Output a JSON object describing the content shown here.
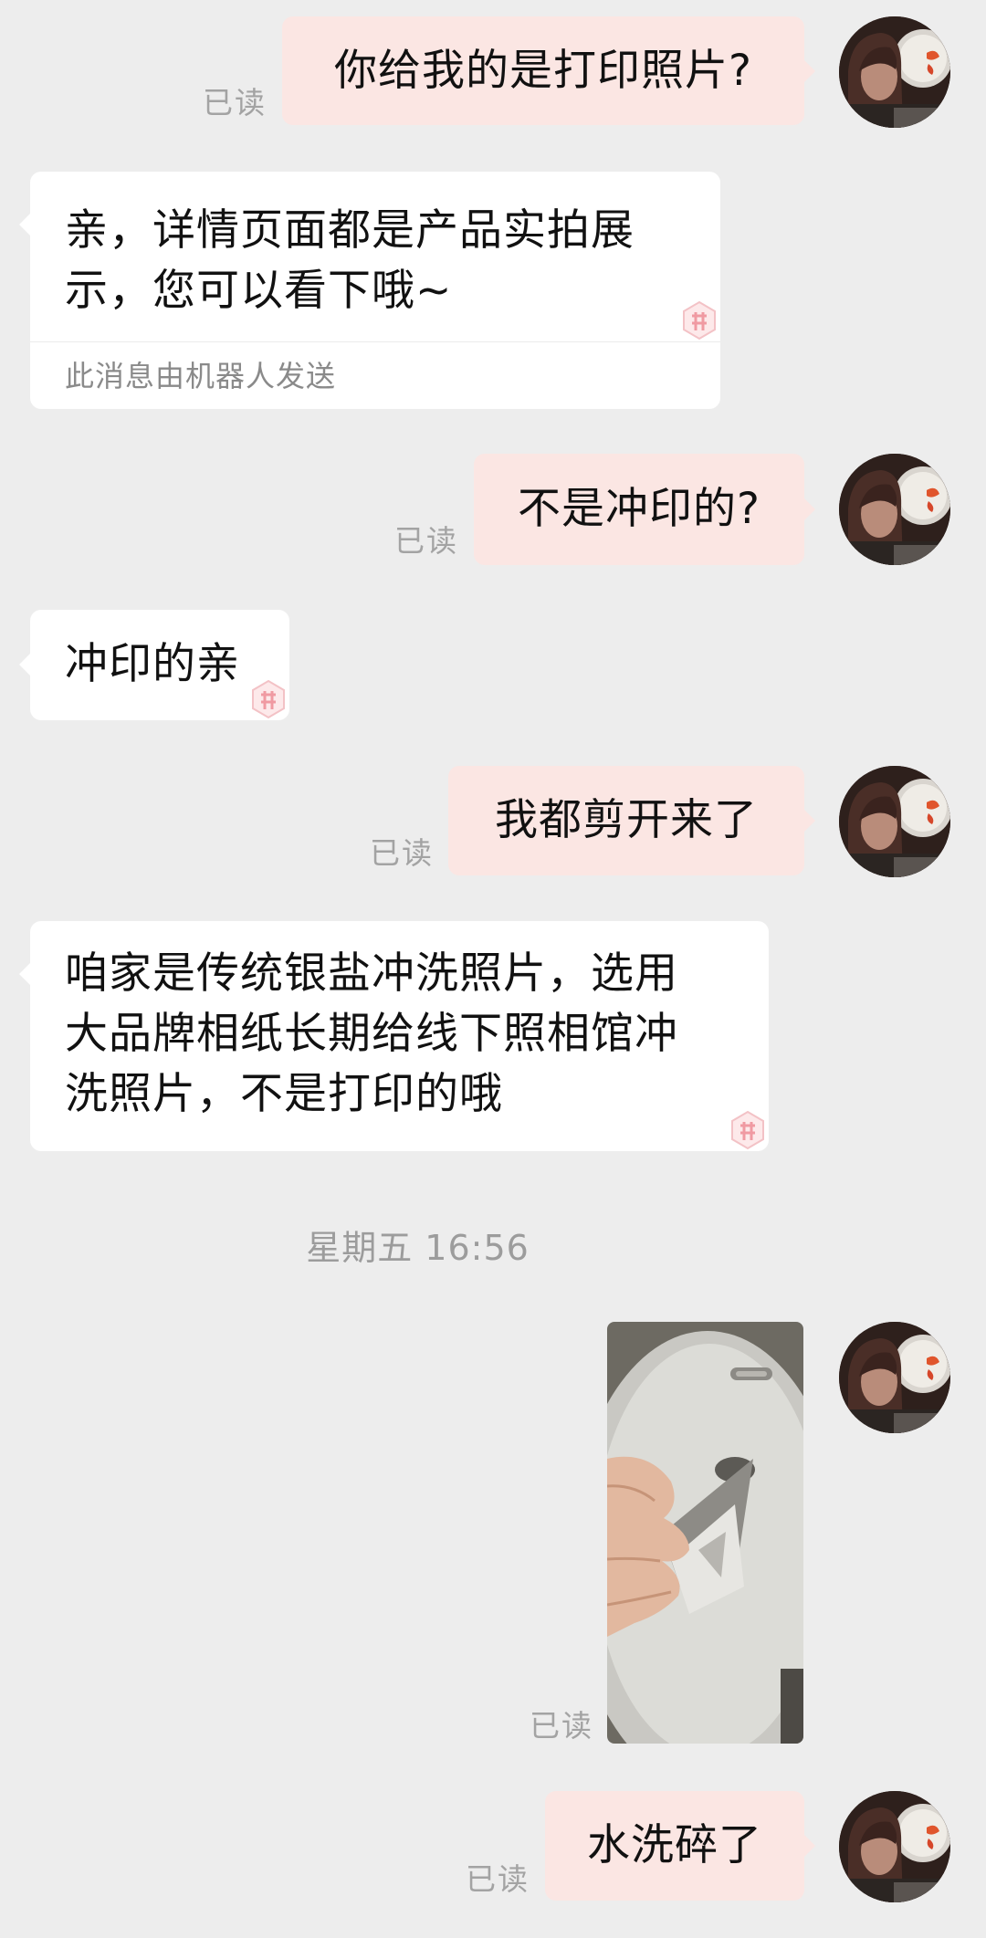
{
  "read_label": "已读",
  "robot_note": "此消息由机器人发送",
  "time_separator": "星期五 16:56",
  "messages": [
    {
      "side": "right",
      "text": "你给我的是打印照片?"
    },
    {
      "side": "left",
      "text": "亲，详情页面都是产品实拍展\n示，您可以看下哦~"
    },
    {
      "side": "right",
      "text": "不是冲印的?"
    },
    {
      "side": "left",
      "text": "冲印的亲"
    },
    {
      "side": "right",
      "text": "我都剪开来了"
    },
    {
      "side": "left",
      "text": "咱家是传统银盐冲洗照片，选用\n大品牌相纸长期给线下照相馆冲\n洗照片，不是打印的哦"
    },
    {
      "side": "right",
      "text": "水洗碎了"
    }
  ],
  "colors": {
    "background": "#ededed",
    "outgoing_bubble": "#fbe6e3",
    "incoming_bubble": "#ffffff",
    "muted_text": "#a3a3a3"
  },
  "icons": {
    "avatar": "user-avatar",
    "badge": "pinduoduo-badge-icon"
  }
}
